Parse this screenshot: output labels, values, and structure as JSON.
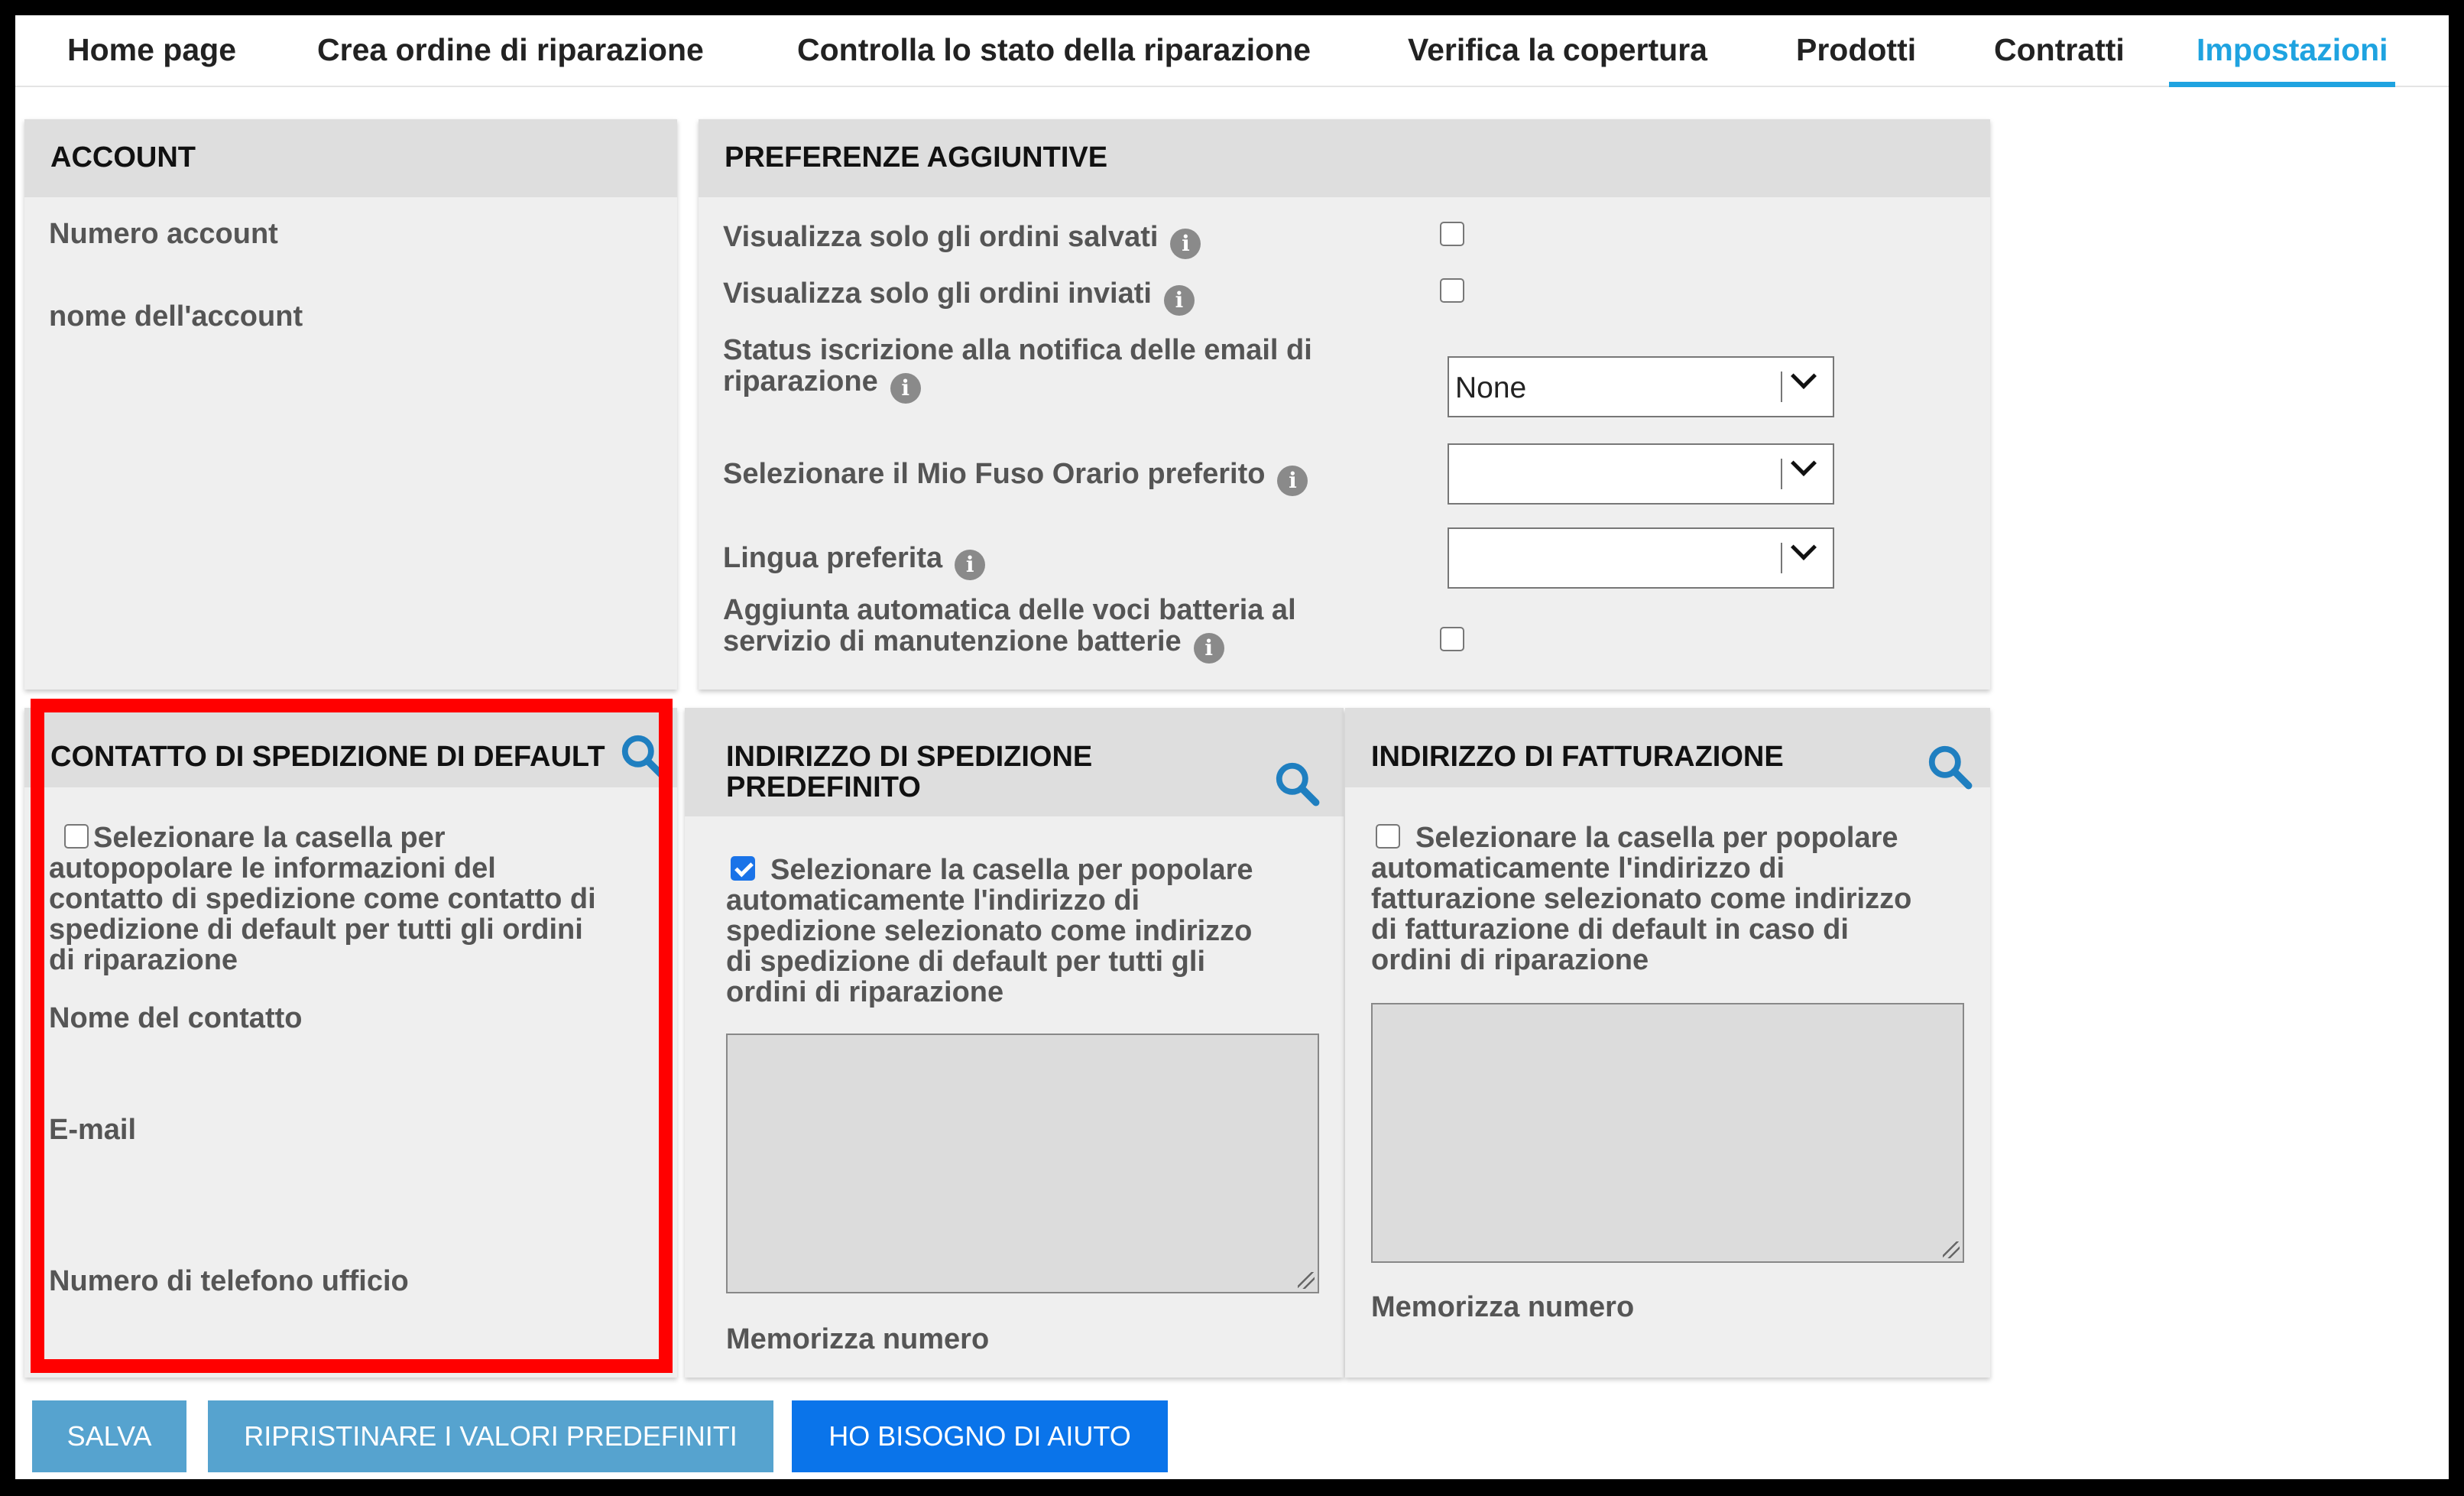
{
  "nav": {
    "tabs": [
      {
        "label": "Home page"
      },
      {
        "label": "Crea ordine di riparazione"
      },
      {
        "label": "Controlla lo stato della riparazione"
      },
      {
        "label": "Verifica la copertura"
      },
      {
        "label": "Prodotti"
      },
      {
        "label": "Contratti"
      },
      {
        "label": "Impostazioni",
        "active": true
      }
    ]
  },
  "account": {
    "title": "ACCOUNT",
    "number_label": "Numero account",
    "name_label": "nome dell'account"
  },
  "preferences": {
    "title": "PREFERENZE AGGIUNTIVE",
    "saved_label": "Visualizza solo gli ordini salvati",
    "sent_label": "Visualizza solo gli ordini inviati",
    "email_label_1": "Status iscrizione alla notifica delle email di",
    "email_label_2": "riparazione",
    "email_value": "None",
    "timezone_label": "Selezionare il Mio Fuso Orario preferito",
    "timezone_value": "",
    "language_label": "Lingua preferita",
    "language_value": "",
    "battery_label_1": "Aggiunta automatica delle voci batteria al",
    "battery_label_2": "servizio di manutenzione batterie"
  },
  "shipping_contact": {
    "title": "CONTATTO DI SPEDIZIONE DI DEFAULT",
    "checkbox_lines": [
      "Selezionare la casella per",
      "autopopolare le informazioni del",
      "contatto di spedizione come contatto di",
      "spedizione di default per tutti gli ordini",
      "di riparazione"
    ],
    "name_label": "Nome del contatto",
    "email_label": "E-mail",
    "phone_label": "Numero di telefono ufficio"
  },
  "shipping_address": {
    "title_lines": [
      "INDIRIZZO DI SPEDIZIONE",
      "PREDEFINITO"
    ],
    "checked": true,
    "checkbox_lines": [
      "Selezionare la casella per popolare",
      "automaticamente l'indirizzo di",
      "spedizione selezionato come indirizzo",
      "di spedizione di default per tutti gli",
      "ordini di riparazione"
    ],
    "store_label": "Memorizza numero"
  },
  "billing_address": {
    "title": "INDIRIZZO DI FATTURAZIONE",
    "checked": false,
    "checkbox_lines": [
      "Selezionare la casella per popolare",
      "automaticamente l'indirizzo di",
      "fatturazione selezionato come indirizzo",
      "di fatturazione di default in caso di",
      "ordini di riparazione"
    ],
    "store_label": "Memorizza numero"
  },
  "buttons": {
    "save": "SALVA",
    "reset": "RIPRISTINARE I VALORI PREDEFINITI",
    "help": "HO BISOGNO DI AIUTO"
  },
  "colors": {
    "accent": "#1fa3e0",
    "highlight": "#ff0000",
    "button_gray": "#56a3cf",
    "button_blue": "#0a74ea"
  },
  "icons": {
    "info": "info-icon",
    "search": "search-icon",
    "dropdown": "chevron-down-icon"
  }
}
